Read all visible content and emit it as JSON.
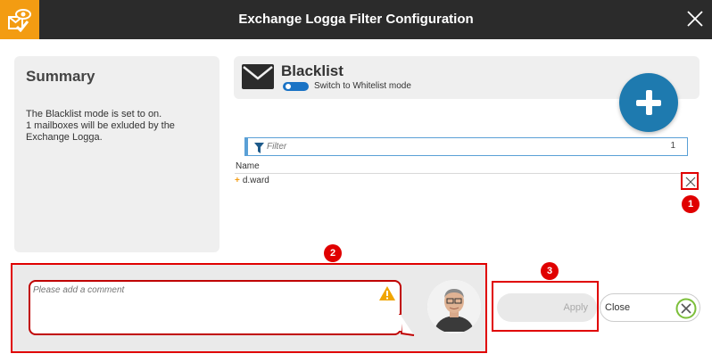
{
  "window": {
    "title": "Exchange Logga Filter Configuration"
  },
  "summary": {
    "title": "Summary",
    "line1": "The Blacklist mode is set to on.",
    "line2": "1 mailboxes will be exluded by the",
    "line3": "Exchange Logga."
  },
  "filter_mode": {
    "title": "Blacklist",
    "toggle_label": "Switch to Whitelist mode"
  },
  "filter": {
    "placeholder": "Filter",
    "count": "1"
  },
  "table": {
    "column": "Name",
    "rows": [
      {
        "name": "d.ward"
      }
    ]
  },
  "comment": {
    "placeholder": "Please add a comment"
  },
  "buttons": {
    "apply": "Apply",
    "close": "Close"
  },
  "badges": {
    "one": "1",
    "two": "2",
    "three": "3"
  },
  "colors": {
    "accent": "#f39c12",
    "primary": "#1e7aaf",
    "highlight": "#e00000",
    "titlebar": "#2b2b2b",
    "close_icon": "#7cbf3a"
  }
}
